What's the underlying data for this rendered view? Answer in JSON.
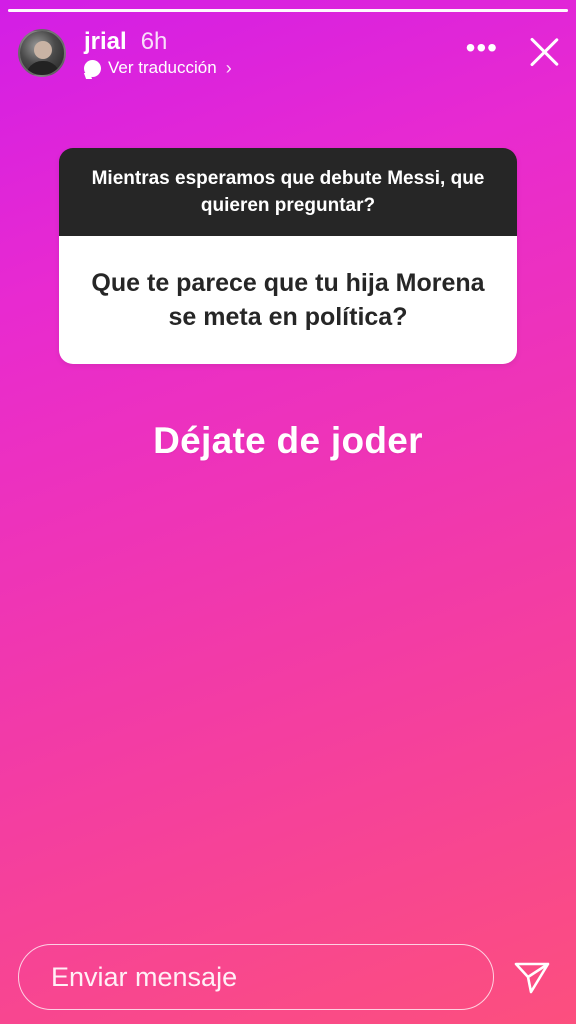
{
  "story": {
    "progress": 1.0
  },
  "header": {
    "username": "jrial",
    "time": "6h",
    "translate_label": "Ver traducción",
    "chevron": "›",
    "more_label": "•••",
    "icons": {
      "avatar": "profile-photo",
      "translate": "speech-bubble-icon",
      "more": "more-dots-icon",
      "close": "close-icon"
    }
  },
  "question": {
    "prompt": "Mientras esperamos que debute Messi, que quieren preguntar?",
    "text": "Que te parece que tu hija Morena se meta en política?"
  },
  "answer": {
    "text": "Déjate de joder"
  },
  "reply": {
    "placeholder": "Enviar mensaje",
    "send_icon": "paper-plane-icon"
  },
  "colors": {
    "gradient_start": "#d21ee6",
    "gradient_end": "#fc4f7e",
    "question_header_bg": "#262626",
    "question_body_bg": "#ffffff"
  }
}
